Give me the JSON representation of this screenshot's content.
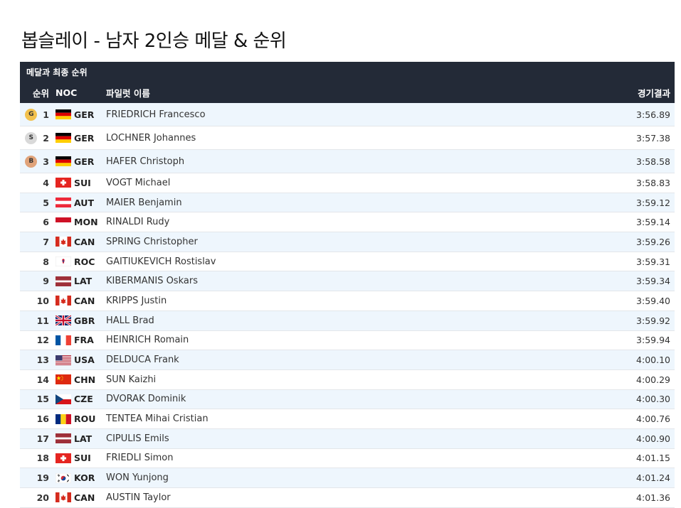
{
  "title": "봅슬레이 - 남자 2인승 메달 & 순위",
  "table": {
    "caption": "메달과 최종 순위",
    "headers": {
      "rank": "순위",
      "noc": "NOC",
      "pilot": "파일럿 이름",
      "result": "경기결과"
    },
    "medal_colors": {
      "G": "#f2c14e",
      "S": "#d9d9d9",
      "B": "#e0a37a"
    },
    "rows": [
      {
        "medal": "G",
        "rank": "1",
        "noc": "GER",
        "name": "FRIEDRICH Francesco",
        "result": "3:56.89"
      },
      {
        "medal": "S",
        "rank": "2",
        "noc": "GER",
        "name": "LOCHNER Johannes",
        "result": "3:57.38"
      },
      {
        "medal": "B",
        "rank": "3",
        "noc": "GER",
        "name": "HAFER Christoph",
        "result": "3:58.58"
      },
      {
        "medal": "",
        "rank": "4",
        "noc": "SUI",
        "name": "VOGT Michael",
        "result": "3:58.83"
      },
      {
        "medal": "",
        "rank": "5",
        "noc": "AUT",
        "name": "MAIER Benjamin",
        "result": "3:59.12"
      },
      {
        "medal": "",
        "rank": "6",
        "noc": "MON",
        "name": "RINALDI Rudy",
        "result": "3:59.14"
      },
      {
        "medal": "",
        "rank": "7",
        "noc": "CAN",
        "name": "SPRING Christopher",
        "result": "3:59.26"
      },
      {
        "medal": "",
        "rank": "8",
        "noc": "ROC",
        "name": "GAITIUKEVICH Rostislav",
        "result": "3:59.31"
      },
      {
        "medal": "",
        "rank": "9",
        "noc": "LAT",
        "name": "KIBERMANIS Oskars",
        "result": "3:59.34"
      },
      {
        "medal": "",
        "rank": "10",
        "noc": "CAN",
        "name": "KRIPPS Justin",
        "result": "3:59.40"
      },
      {
        "medal": "",
        "rank": "11",
        "noc": "GBR",
        "name": "HALL Brad",
        "result": "3:59.92"
      },
      {
        "medal": "",
        "rank": "12",
        "noc": "FRA",
        "name": "HEINRICH Romain",
        "result": "3:59.94"
      },
      {
        "medal": "",
        "rank": "13",
        "noc": "USA",
        "name": "DELDUCA Frank",
        "result": "4:00.10"
      },
      {
        "medal": "",
        "rank": "14",
        "noc": "CHN",
        "name": "SUN Kaizhi",
        "result": "4:00.29"
      },
      {
        "medal": "",
        "rank": "15",
        "noc": "CZE",
        "name": "DVORAK Dominik",
        "result": "4:00.30"
      },
      {
        "medal": "",
        "rank": "16",
        "noc": "ROU",
        "name": "TENTEA Mihai Cristian",
        "result": "4:00.76"
      },
      {
        "medal": "",
        "rank": "17",
        "noc": "LAT",
        "name": "CIPULIS Emils",
        "result": "4:00.90"
      },
      {
        "medal": "",
        "rank": "18",
        "noc": "SUI",
        "name": "FRIEDLI Simon",
        "result": "4:01.15"
      },
      {
        "medal": "",
        "rank": "19",
        "noc": "KOR",
        "name": "WON Yunjong",
        "result": "4:01.24"
      },
      {
        "medal": "",
        "rank": "20",
        "noc": "CAN",
        "name": "AUSTIN Taylor",
        "result": "4:01.36"
      }
    ]
  }
}
